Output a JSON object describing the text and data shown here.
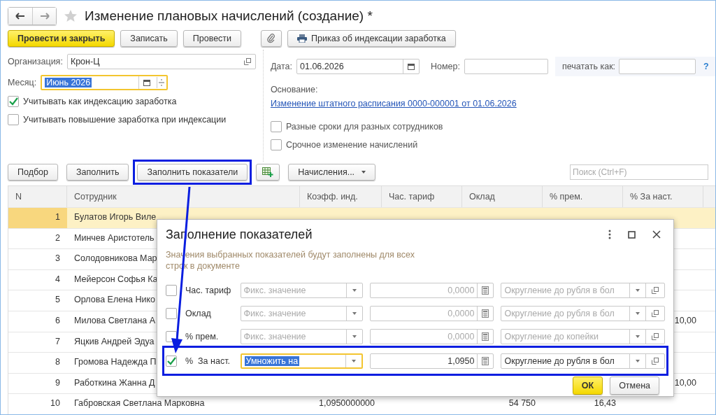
{
  "window": {
    "title": "Изменение плановых начислений (создание) *",
    "favorite": false
  },
  "command_bar": [
    {
      "kind": "primary",
      "label": "Провести и закрыть"
    },
    {
      "kind": "plain",
      "label": "Записать"
    },
    {
      "kind": "plain",
      "label": "Провести"
    },
    {
      "kind": "attach"
    },
    {
      "kind": "print",
      "label": "Приказ об индексации заработка"
    }
  ],
  "form": {
    "organization": {
      "label": "Организация:",
      "value": "Крон-Ц"
    },
    "month": {
      "label": "Месяц:",
      "value": "Июнь 2026",
      "focused": true
    },
    "options": [
      {
        "label": "Учитывать как индексацию заработка",
        "checked": true
      },
      {
        "label": "Учитывать повышение заработка при индексации",
        "checked": false
      }
    ],
    "date": {
      "label": "Дата:",
      "value": "01.06.2026"
    },
    "number": {
      "label": "Номер:"
    },
    "print_as": {
      "label": "печатать как:",
      "help": "?"
    },
    "basis": {
      "label": "Основание:",
      "link": "Изменение штатного расписания 0000-000001 от 01.06.2026"
    },
    "extra_options": [
      {
        "label": "Разные сроки для разных сотрудников",
        "checked": false
      },
      {
        "label": "Срочное изменение начислений",
        "checked": false
      }
    ]
  },
  "table_bar": {
    "buttons": [
      {
        "kind": "plain",
        "label": "Подбор",
        "highlighted": false
      },
      {
        "kind": "plain",
        "label": "Заполнить",
        "highlighted": false
      },
      {
        "kind": "plain",
        "label": "Заполнить показатели",
        "highlighted": true
      },
      {
        "kind": "add-grid",
        "highlighted": false
      },
      {
        "kind": "menu",
        "label": "Начисления...",
        "highlighted": false
      }
    ],
    "search": {
      "placeholder": "Поиск (Ctrl+F)"
    }
  },
  "table": {
    "columns": [
      "N",
      "Сотрудник",
      "Коэфф. инд.",
      "Час. тариф",
      "Оклад",
      "% прем.",
      "%  За наст."
    ],
    "rows": [
      {
        "selected": true,
        "cells": {
          "n": "1",
          "employee": "Булатов Игорь Виле"
        }
      },
      {
        "selected": false,
        "cells": {
          "n": "2",
          "employee": "Минчев Аристотель"
        }
      },
      {
        "selected": false,
        "cells": {
          "n": "3",
          "employee": "Солодовникова Мар"
        }
      },
      {
        "selected": false,
        "cells": {
          "n": "4",
          "employee": "Мейерсон Софья Ка"
        }
      },
      {
        "selected": false,
        "cells": {
          "n": "5",
          "employee": "Орлова Елена Нико"
        }
      },
      {
        "selected": false,
        "cells": {
          "n": "6",
          "employee": "Милова Светлана А",
          "extra": "10,00"
        }
      },
      {
        "selected": false,
        "cells": {
          "n": "7",
          "employee": "Яцкив Андрей Эдуа"
        }
      },
      {
        "selected": false,
        "cells": {
          "n": "8",
          "employee": "Громова Надежда П"
        }
      },
      {
        "selected": false,
        "cells": {
          "n": "9",
          "employee": "Работкина Жанна Д",
          "extra": "10,00"
        }
      },
      {
        "selected": false,
        "cells": {
          "n": "10",
          "employee": "Габровская Светлана Марковна",
          "coef": "1,0950000000",
          "salary": "54 750",
          "bonus": "16,43"
        }
      }
    ]
  },
  "dialog": {
    "title": "Заполнение показателей",
    "description": "Значения выбранных показателей будут заполнены для всех строк в документе",
    "rows": [
      {
        "checked": false,
        "label": "Час. тариф",
        "mode": "Фикс. значение",
        "value": "0,0000",
        "rounding": "Округление до рубля в бол",
        "focused": false,
        "highlighted": false
      },
      {
        "checked": false,
        "label": "Оклад",
        "mode": "Фикс. значение",
        "value": "0,0000",
        "rounding": "Округление до рубля в бол",
        "focused": false,
        "highlighted": false
      },
      {
        "checked": false,
        "label": "% прем.",
        "mode": "Фикс. значение",
        "value": "0,0000",
        "rounding": "Округление до копейки",
        "focused": false,
        "highlighted": false
      },
      {
        "checked": true,
        "label": "%  За наст.",
        "mode": "Умножить на",
        "value": "1,0950",
        "rounding": "Округление до рубля в бол",
        "focused": true,
        "highlighted": true
      }
    ],
    "buttons": [
      {
        "kind": "primary",
        "label": "ОК"
      },
      {
        "kind": "plain",
        "label": "Отмена"
      }
    ]
  }
}
